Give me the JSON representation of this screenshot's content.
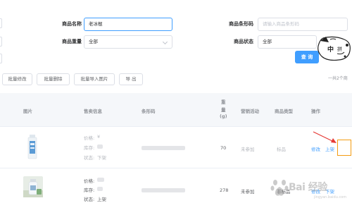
{
  "filters": {
    "name_label": "商品名称",
    "name_value": "老冰棍",
    "barcode_label": "商品条形码",
    "barcode_placeholder": "请输入商品条形码",
    "weight_label": "商品重量",
    "weight_value": "全部",
    "status_label": "商品状态",
    "status_value": "全部",
    "query_label": "查 询"
  },
  "summary": "一共2个商",
  "toolbar": {
    "batch_edit": "批量修改",
    "batch_delete": "批量删除",
    "batch_import_images": "批量导入图片",
    "export": "导 出"
  },
  "table": {
    "headers": {
      "image": "图片",
      "sale_info": "售卖信息",
      "barcode": "条形码",
      "weight_line1": "重",
      "weight_line2": "量",
      "weight_line3": "(g)",
      "promotion": "营销活动",
      "type": "商品类型",
      "actions": "操作"
    },
    "rows": [
      {
        "price_label": "价格:",
        "price_value": "¥",
        "stock_label": "库存:",
        "state_label": "状态:",
        "state_value": "下架",
        "weight": "70",
        "promotion": "未参加",
        "type": "标品",
        "edit": "修改",
        "toggle": "上架"
      },
      {
        "price_label": "价格:",
        "stock_label": "库存:",
        "state_label": "状态:",
        "state_value": "上架",
        "weight": "278",
        "promotion": "未参加",
        "type": "非标品",
        "edit": "修改",
        "toggle": "下架"
      }
    ]
  },
  "sticker": {
    "text1": "中",
    "text2": "拼"
  },
  "watermark": {
    "text": "Bai 经验",
    "sub": "jingyan.baidu.com"
  },
  "colors": {
    "primary": "#409eff",
    "annotation": "#e53935",
    "highlight_box": "#f39c12"
  }
}
